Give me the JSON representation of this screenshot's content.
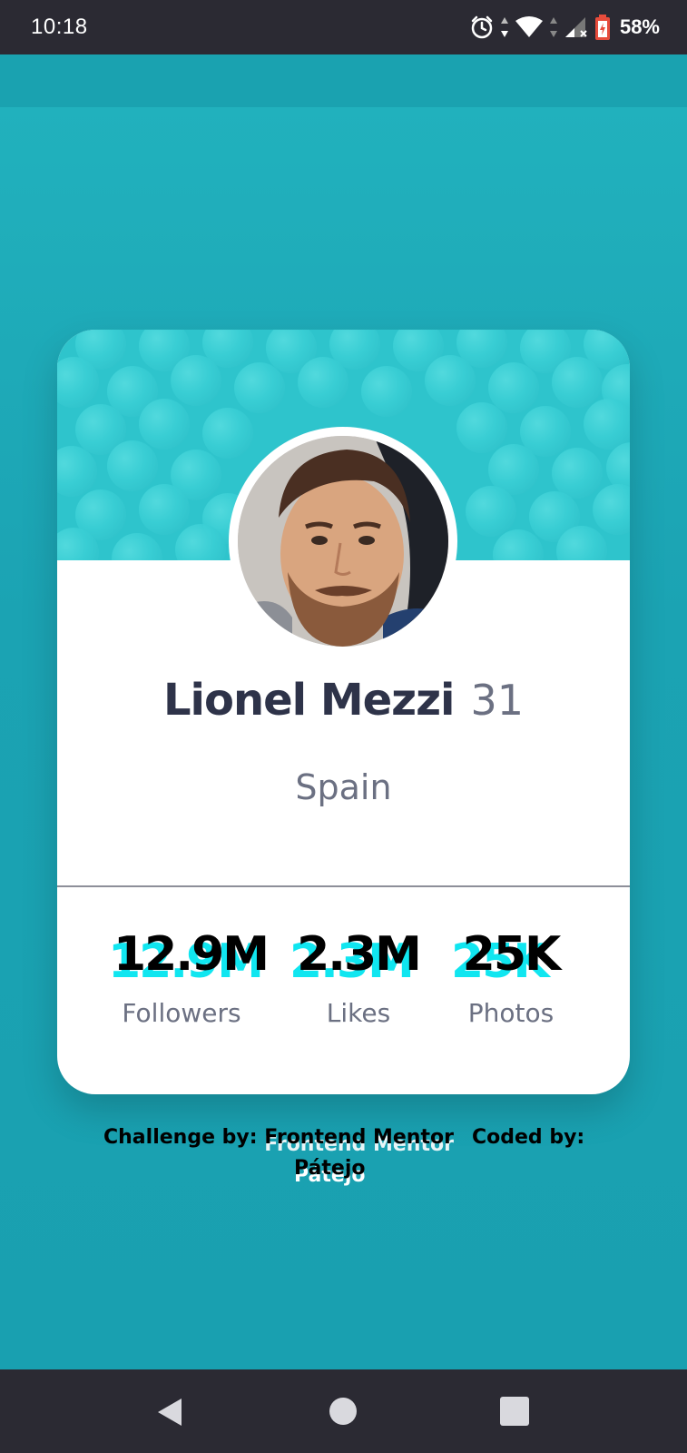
{
  "status_bar": {
    "time": "10:18",
    "battery": "58%"
  },
  "profile": {
    "name": "Lionel Mezzi",
    "age": "31",
    "country": "Spain"
  },
  "stats": [
    {
      "value": "12.9M",
      "label": "Followers"
    },
    {
      "value": "2.3M",
      "label": "Likes"
    },
    {
      "value": "25K",
      "label": "Photos"
    }
  ],
  "attribution": {
    "challenge_prefix": "Challenge by:",
    "challenge_source": "Frontend Mentor",
    "coded_prefix": "Coded by:",
    "coder": "Pátejo"
  },
  "colors": {
    "status_bar": "#2b2a33",
    "page_background": "#1ba1b1",
    "card_header": "#2ec4cc",
    "stat_shadow": "#10e6f0",
    "name_text": "#2e3349",
    "muted_text": "#6b7082"
  },
  "icons": [
    "alarm-icon",
    "wifi-icon",
    "signal-icon",
    "battery-icon",
    "back-icon",
    "home-icon",
    "recents-icon"
  ]
}
